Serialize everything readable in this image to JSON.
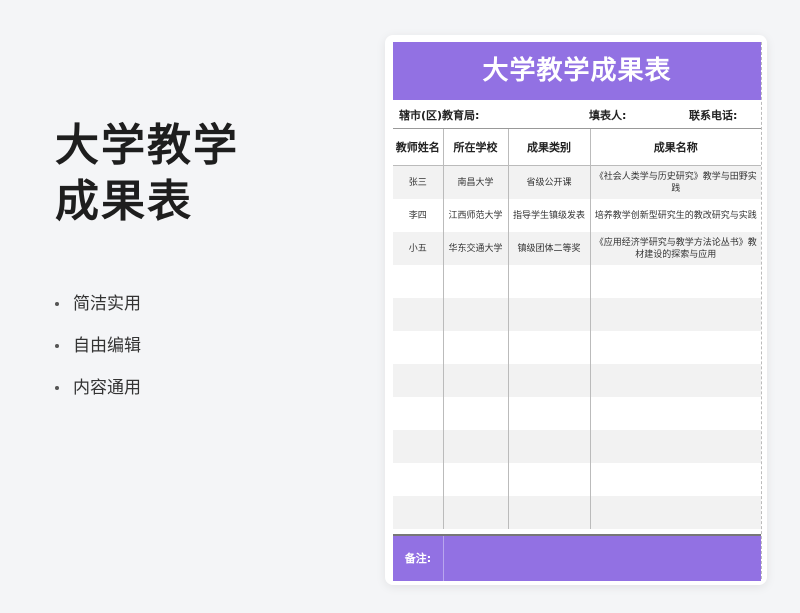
{
  "promo": {
    "title_line1": "大学教学",
    "title_line2": "成果表",
    "features": [
      "简洁实用",
      "自由编辑",
      "内容通用"
    ]
  },
  "sheet": {
    "title": "大学教学成果表",
    "info": {
      "district": "辖市(区)教育局:",
      "filler": "填表人:",
      "phone": "联系电话:"
    },
    "columns": [
      "教师姓名",
      "所在学校",
      "成果类别",
      "成果名称"
    ],
    "rows": [
      [
        "张三",
        "南昌大学",
        "省级公开课",
        "《社会人类学与历史研究》教学与田野实践"
      ],
      [
        "李四",
        "江西师范大学",
        "指导学生镇级发表",
        "培养教学创新型研究生的教改研究与实践"
      ],
      [
        "小五",
        "华东交通大学",
        "镇级团体二等奖",
        "《应用经济学研究与教学方法论丛书》教材建设的探索与应用"
      ]
    ],
    "remark_label": "备注:"
  },
  "colors": {
    "accent": "#9271e3"
  }
}
